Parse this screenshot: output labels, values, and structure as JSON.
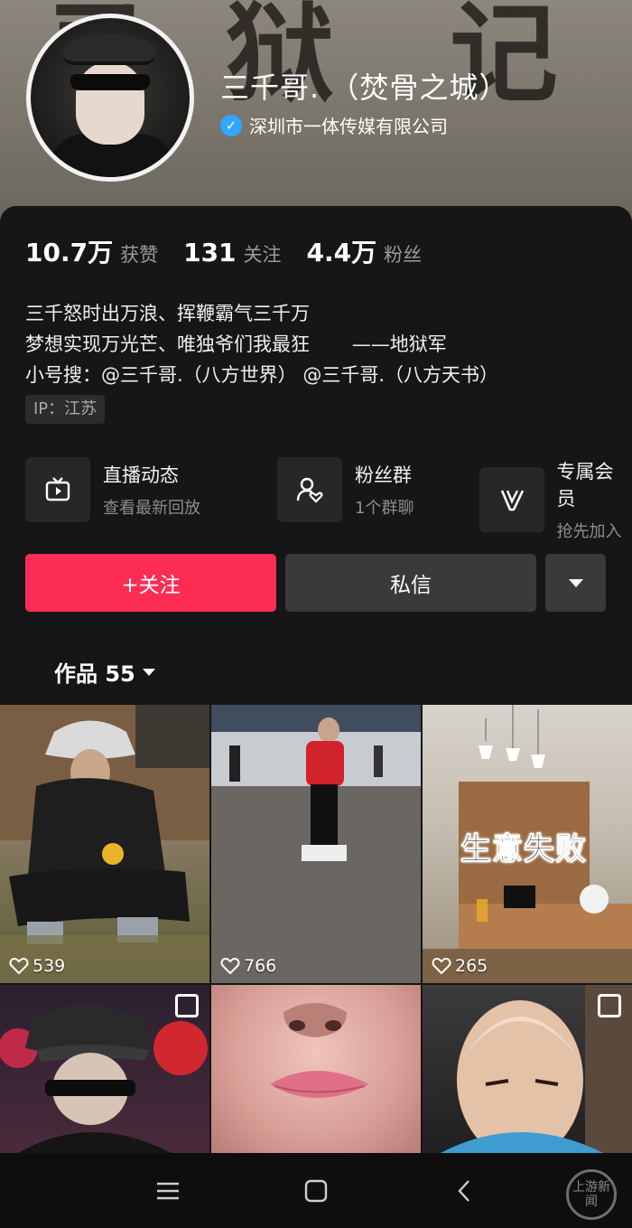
{
  "profile": {
    "name": "三千哥. （焚骨之城）",
    "verified_org": "深圳市一体传媒有限公司",
    "background_text": [
      "录",
      "狱",
      "记"
    ]
  },
  "stats": [
    {
      "value": "10.7万",
      "label": "获赞"
    },
    {
      "value": "131",
      "label": "关注"
    },
    {
      "value": "4.4万",
      "label": "粉丝"
    }
  ],
  "bio": {
    "lines": [
      "三千怒时出万浪、挥鞭霸气三千万",
      "梦想实现万光芒、唯独爷们我最狂       ——地狱军",
      "小号搜：@三千哥.（八方世界） @三千哥.（八方天书）"
    ],
    "ip": "IP：江苏"
  },
  "features": [
    {
      "icon": "tv-icon",
      "title": "直播动态",
      "subtitle": "查看最新回放"
    },
    {
      "icon": "fans-group-icon",
      "title": "粉丝群",
      "subtitle": "1个群聊"
    },
    {
      "icon": "vip-icon",
      "title": "专属会员",
      "subtitle": "抢先加入"
    }
  ],
  "actions": {
    "follow": "+关注",
    "message": "私信",
    "more_icon": "caret-down-icon"
  },
  "works": {
    "label": "作品 55"
  },
  "videos": [
    {
      "likes": "539",
      "overlay": ""
    },
    {
      "likes": "766",
      "overlay": ""
    },
    {
      "likes": "265",
      "overlay": "生意失败"
    },
    {
      "likes": "",
      "overlay": "",
      "multi": true
    },
    {
      "likes": "",
      "overlay": ""
    },
    {
      "likes": "",
      "overlay": "",
      "multi": true
    }
  ],
  "nav": {
    "icons": [
      "menu-icon",
      "home-icon",
      "back-icon"
    ]
  },
  "watermark": "上游新闻",
  "colors": {
    "accent": "#fd2c55",
    "verify": "#33a6ff",
    "background": "#161616"
  }
}
